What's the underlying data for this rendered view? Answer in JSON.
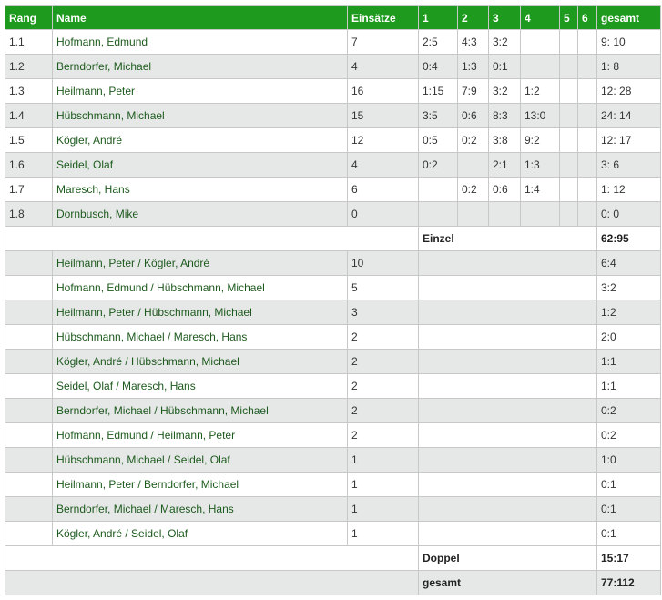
{
  "header": {
    "rang": "Rang",
    "name": "Name",
    "einsaetze": "Einsätze",
    "r1": "1",
    "r2": "2",
    "r3": "3",
    "r4": "4",
    "r5": "5",
    "r6": "6",
    "gesamt": "gesamt"
  },
  "singles": [
    {
      "rang": "1.1",
      "name": "Hofmann, Edmund",
      "einsaetze": "7",
      "r1": "2:5",
      "r2": "4:3",
      "r3": "3:2",
      "r4": "",
      "r5": "",
      "r6": "",
      "gesamt": "9: 10"
    },
    {
      "rang": "1.2",
      "name": "Berndorfer, Michael",
      "einsaetze": "4",
      "r1": "0:4",
      "r2": "1:3",
      "r3": "0:1",
      "r4": "",
      "r5": "",
      "r6": "",
      "gesamt": "1: 8"
    },
    {
      "rang": "1.3",
      "name": "Heilmann, Peter",
      "einsaetze": "16",
      "r1": "1:15",
      "r2": "7:9",
      "r3": "3:2",
      "r4": "1:2",
      "r5": "",
      "r6": "",
      "gesamt": "12: 28"
    },
    {
      "rang": "1.4",
      "name": "Hübschmann, Michael",
      "einsaetze": "15",
      "r1": "3:5",
      "r2": "0:6",
      "r3": "8:3",
      "r4": "13:0",
      "r5": "",
      "r6": "",
      "gesamt": "24: 14"
    },
    {
      "rang": "1.5",
      "name": "Kögler, André",
      "einsaetze": "12",
      "r1": "0:5",
      "r2": "0:2",
      "r3": "3:8",
      "r4": "9:2",
      "r5": "",
      "r6": "",
      "gesamt": "12: 17"
    },
    {
      "rang": "1.6",
      "name": "Seidel, Olaf",
      "einsaetze": "4",
      "r1": "0:2",
      "r2": "",
      "r3": "2:1",
      "r4": "1:3",
      "r5": "",
      "r6": "",
      "gesamt": "3: 6"
    },
    {
      "rang": "1.7",
      "name": "Maresch, Hans",
      "einsaetze": "6",
      "r1": "",
      "r2": "0:2",
      "r3": "0:6",
      "r4": "1:4",
      "r5": "",
      "r6": "",
      "gesamt": "1: 12"
    },
    {
      "rang": "1.8",
      "name": "Dornbusch, Mike",
      "einsaetze": "0",
      "r1": "",
      "r2": "",
      "r3": "",
      "r4": "",
      "r5": "",
      "r6": "",
      "gesamt": "0: 0"
    }
  ],
  "einzel_total": {
    "label": "Einzel",
    "value": "62:95"
  },
  "doubles": [
    {
      "name": "Heilmann, Peter / Kögler, André",
      "einsaetze": "10",
      "gesamt": "6:4"
    },
    {
      "name": "Hofmann, Edmund / Hübschmann, Michael",
      "einsaetze": "5",
      "gesamt": "3:2"
    },
    {
      "name": "Heilmann, Peter / Hübschmann, Michael",
      "einsaetze": "3",
      "gesamt": "1:2"
    },
    {
      "name": "Hübschmann, Michael / Maresch, Hans",
      "einsaetze": "2",
      "gesamt": "2:0"
    },
    {
      "name": "Kögler, André / Hübschmann, Michael",
      "einsaetze": "2",
      "gesamt": "1:1"
    },
    {
      "name": "Seidel, Olaf / Maresch, Hans",
      "einsaetze": "2",
      "gesamt": "1:1"
    },
    {
      "name": "Berndorfer, Michael / Hübschmann, Michael",
      "einsaetze": "2",
      "gesamt": "0:2"
    },
    {
      "name": "Hofmann, Edmund / Heilmann, Peter",
      "einsaetze": "2",
      "gesamt": "0:2"
    },
    {
      "name": "Hübschmann, Michael / Seidel, Olaf",
      "einsaetze": "1",
      "gesamt": "1:0"
    },
    {
      "name": "Heilmann, Peter / Berndorfer, Michael",
      "einsaetze": "1",
      "gesamt": "0:1"
    },
    {
      "name": "Berndorfer, Michael / Maresch, Hans",
      "einsaetze": "1",
      "gesamt": "0:1"
    },
    {
      "name": "Kögler, André / Seidel, Olaf",
      "einsaetze": "1",
      "gesamt": "0:1"
    }
  ],
  "doppel_total": {
    "label": "Doppel",
    "value": "15:17"
  },
  "grand_total": {
    "label": "gesamt",
    "value": "77:112"
  },
  "colors": {
    "header_bg": "#1e9a1e",
    "header_text": "#ffffff",
    "row_alt": "#e6e8e8",
    "link_text": "#1d5a1d"
  }
}
